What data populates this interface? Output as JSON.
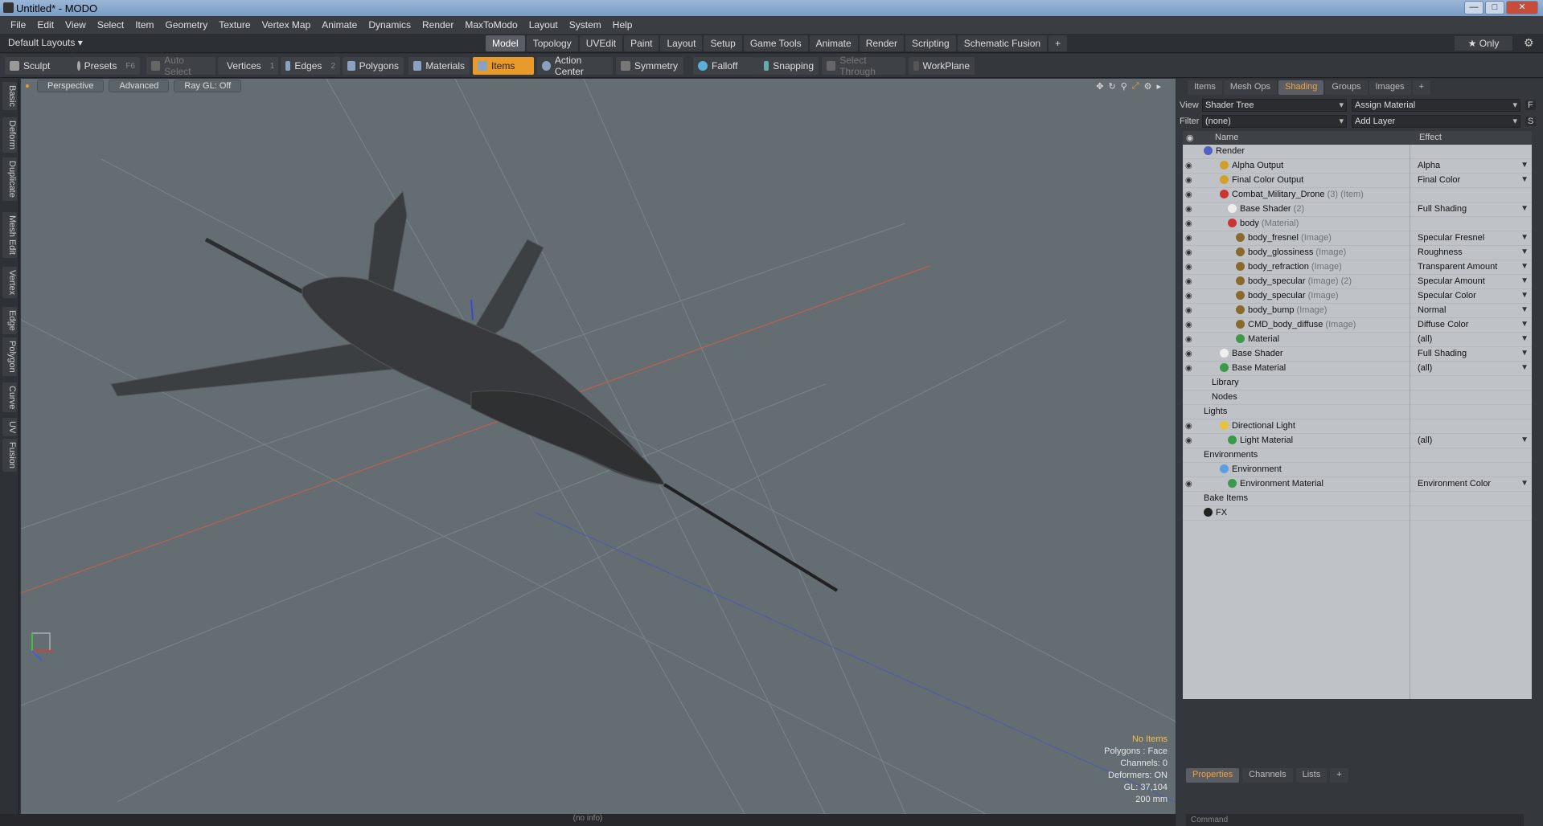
{
  "window": {
    "title": "Untitled* - MODO",
    "min": "—",
    "max": "□",
    "close": "✕"
  },
  "menu": [
    "File",
    "Edit",
    "View",
    "Select",
    "Item",
    "Geometry",
    "Texture",
    "Vertex Map",
    "Animate",
    "Dynamics",
    "Render",
    "MaxToModo",
    "Layout",
    "System",
    "Help"
  ],
  "layouts": {
    "label": "Default Layouts ▾",
    "tabs": [
      "Model",
      "Topology",
      "UVEdit",
      "Paint",
      "Layout",
      "Setup",
      "Game Tools",
      "Animate",
      "Render",
      "Scripting",
      "Schematic Fusion",
      "+"
    ],
    "active": "Model",
    "only": "★ Only"
  },
  "toolbar": {
    "sculpt": "Sculpt",
    "presets": "Presets",
    "presets_key": "F6",
    "auto_select": "Auto Select",
    "vertices": "Vertices",
    "vertices_key": "1",
    "edges": "Edges",
    "edges_key": "2",
    "polygons": "Polygons",
    "materials": "Materials",
    "items": "Items",
    "action_center": "Action Center",
    "symmetry": "Symmetry",
    "falloff": "Falloff",
    "snapping": "Snapping",
    "select_through": "Select Through",
    "workplane": "WorkPlane"
  },
  "left_tabs": [
    "Basic",
    "Deform",
    "Duplicate",
    "Mesh Edit",
    "Vertex",
    "Edge",
    "Polygon",
    "Curve",
    "UV",
    "Fusion"
  ],
  "viewport": {
    "perspective": "Perspective",
    "advanced": "Advanced",
    "raygl": "Ray GL: Off",
    "info": {
      "items": "No Items",
      "polygons": "Polygons : Face",
      "channels": "Channels: 0",
      "deformers": "Deformers: ON",
      "gl": "GL: 37,104",
      "size": "200 mm"
    }
  },
  "status": "(no info)",
  "right": {
    "tabs": [
      "Items",
      "Mesh Ops",
      "Shading",
      "Groups",
      "Images",
      "+"
    ],
    "active": "Shading",
    "view_label": "View",
    "view_value": "Shader Tree",
    "assign": "Assign Material",
    "f_btn": "F",
    "filter_label": "Filter",
    "filter_value": "(none)",
    "add_layer": "Add Layer",
    "s_btn": "S",
    "col_name": "Name",
    "col_effect": "Effect",
    "rows": [
      {
        "name": "Render",
        "sub": "",
        "effect": "",
        "indent": 0,
        "ball": "#5060c0",
        "eye": false
      },
      {
        "name": "Alpha Output",
        "sub": "",
        "effect": "Alpha",
        "indent": 2,
        "ball": "#d2a02a",
        "eye": true
      },
      {
        "name": "Final Color Output",
        "sub": "",
        "effect": "Final Color",
        "indent": 2,
        "ball": "#d2a02a",
        "eye": true
      },
      {
        "name": "Combat_Military_Drone",
        "sub": " (3) (Item)",
        "effect": "",
        "indent": 2,
        "ball": "#c33",
        "eye": true
      },
      {
        "name": "Base Shader",
        "sub": " (2)",
        "effect": "Full Shading",
        "indent": 3,
        "ball": "#eee",
        "eye": true
      },
      {
        "name": "body",
        "sub": " (Material)",
        "effect": "",
        "indent": 3,
        "ball": "#c33",
        "eye": true
      },
      {
        "name": "body_fresnel",
        "sub": " (Image)",
        "effect": "Specular Fresnel",
        "indent": 4,
        "ball": "#8a6a2a",
        "eye": true
      },
      {
        "name": "body_glossiness",
        "sub": " (Image)",
        "effect": "Roughness",
        "indent": 4,
        "ball": "#8a6a2a",
        "eye": true
      },
      {
        "name": "body_refraction",
        "sub": " (Image)",
        "effect": "Transparent Amount",
        "indent": 4,
        "ball": "#8a6a2a",
        "eye": true
      },
      {
        "name": "body_specular",
        "sub": " (Image) (2)",
        "effect": "Specular Amount",
        "indent": 4,
        "ball": "#8a6a2a",
        "eye": true
      },
      {
        "name": "body_specular",
        "sub": " (Image)",
        "effect": "Specular Color",
        "indent": 4,
        "ball": "#8a6a2a",
        "eye": true
      },
      {
        "name": "body_bump",
        "sub": " (Image)",
        "effect": "Normal",
        "indent": 4,
        "ball": "#8a6a2a",
        "eye": true
      },
      {
        "name": "CMD_body_diffuse",
        "sub": " (Image)",
        "effect": "Diffuse Color",
        "indent": 4,
        "ball": "#8a6a2a",
        "eye": true
      },
      {
        "name": "Material",
        "sub": "",
        "effect": "(all)",
        "indent": 4,
        "ball": "#3a9a4a",
        "eye": true
      },
      {
        "name": "Base Shader",
        "sub": "",
        "effect": "Full Shading",
        "indent": 2,
        "ball": "#eee",
        "eye": true
      },
      {
        "name": "Base Material",
        "sub": "",
        "effect": "(all)",
        "indent": 2,
        "ball": "#3a9a4a",
        "eye": true
      },
      {
        "name": "Library",
        "sub": "",
        "effect": "",
        "indent": 1,
        "ball": "",
        "eye": false
      },
      {
        "name": "Nodes",
        "sub": "",
        "effect": "",
        "indent": 1,
        "ball": "",
        "eye": false
      },
      {
        "name": "Lights",
        "sub": "",
        "effect": "",
        "indent": 0,
        "ball": "",
        "eye": false
      },
      {
        "name": "Directional Light",
        "sub": "",
        "effect": "",
        "indent": 2,
        "ball": "#e8c23a",
        "eye": true
      },
      {
        "name": "Light Material",
        "sub": "",
        "effect": "(all)",
        "indent": 3,
        "ball": "#3a9a4a",
        "eye": true
      },
      {
        "name": "Environments",
        "sub": "",
        "effect": "",
        "indent": 0,
        "ball": "",
        "eye": false
      },
      {
        "name": "Environment",
        "sub": "",
        "effect": "",
        "indent": 2,
        "ball": "#5aa0e0",
        "eye": false
      },
      {
        "name": "Environment Material",
        "sub": "",
        "effect": "Environment Color",
        "indent": 3,
        "ball": "#3a9a4a",
        "eye": true
      },
      {
        "name": "Bake Items",
        "sub": "",
        "effect": "",
        "indent": 0,
        "ball": "",
        "eye": false
      },
      {
        "name": "FX",
        "sub": "",
        "effect": "",
        "indent": 0,
        "ball": "#222",
        "eye": false
      }
    ],
    "prop_tabs": [
      "Properties",
      "Channels",
      "Lists",
      "+"
    ],
    "prop_active": "Properties",
    "command": "Command"
  }
}
